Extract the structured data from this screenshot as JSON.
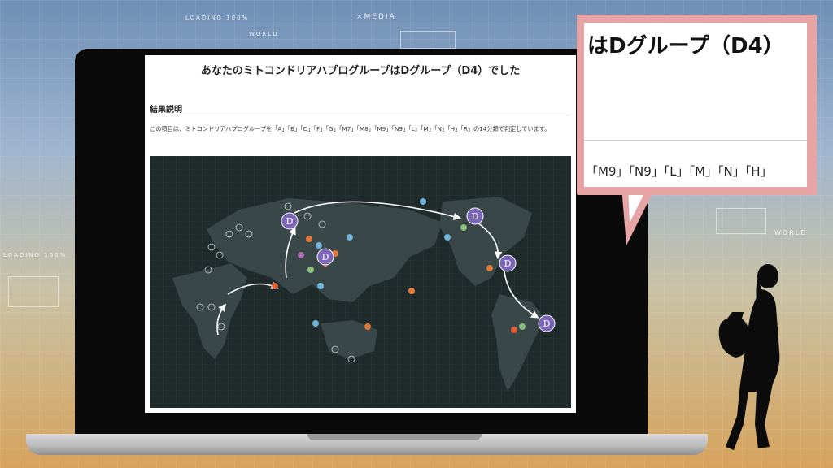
{
  "background": {
    "deco_texts": [
      "LOADING 100%",
      "×MEDIA",
      "WORLD",
      "LOADING 100%",
      "WORLD"
    ]
  },
  "page": {
    "title": "あなたのミトコンドリアハプログループはDグループ（D4）でした",
    "section_heading": "結果説明",
    "description": "この項目は、ミトコンドリアハプログループを「A」「B」「D」「F」「G」「M7」「M8」「M9」「N9」「L」「M」「N」「H」「R」の14分類で判定しています。"
  },
  "map": {
    "labels": [
      "D",
      "D",
      "D",
      "D",
      "D"
    ]
  },
  "callout": {
    "title": "はDグループ（D4）",
    "groups": "「M9」「N9」「L」「M」「N」「H」"
  },
  "colors": {
    "accent_purple": "#7b66b8",
    "callout_border": "#e7a4a4",
    "map_bg": "#1f2a2b"
  }
}
